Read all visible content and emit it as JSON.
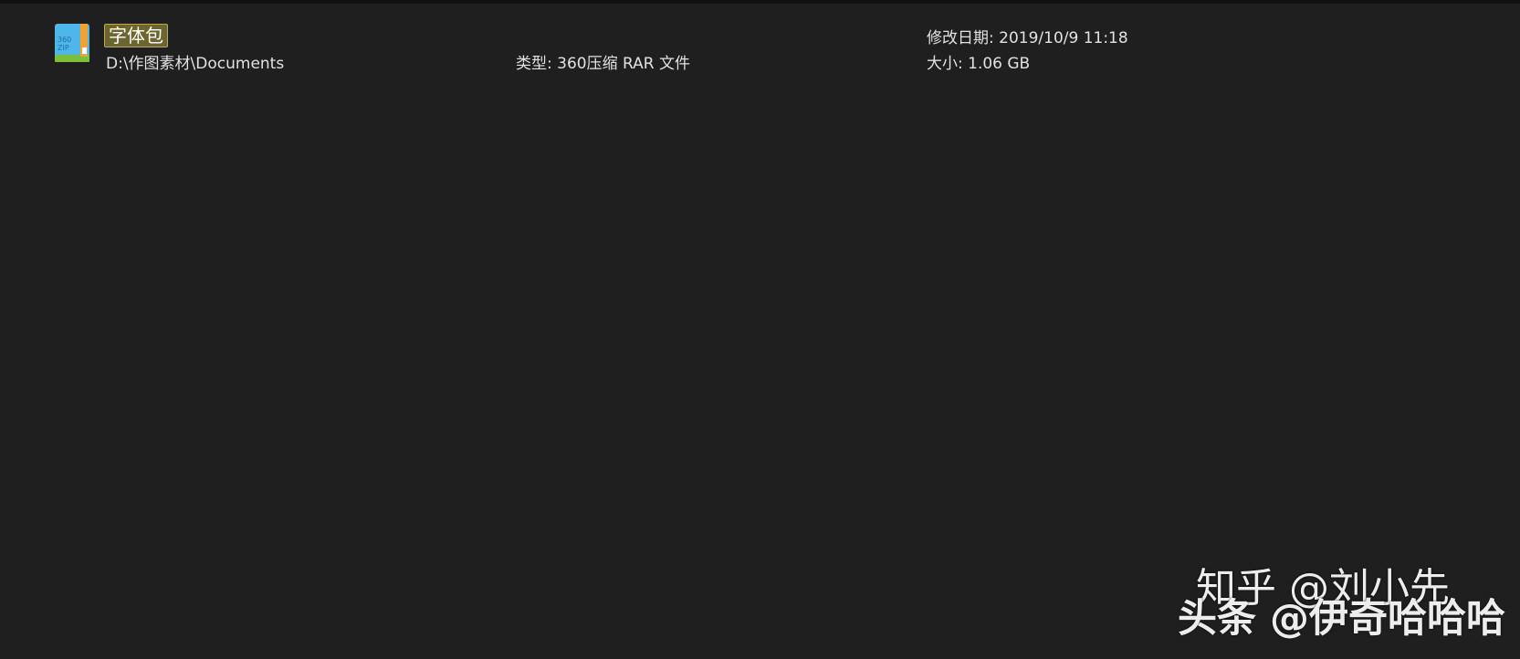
{
  "search_result": {
    "name": "字体包",
    "path": "D:\\作图素材\\Documents",
    "type_label": "类型: 360压缩 RAR 文件",
    "modified_label": "修改日期: 2019/10/9 11:18",
    "size_label": "大小: 1.06 GB",
    "icon": "archive-rar-icon",
    "icon_text_top": "360",
    "icon_text_bottom": "ZIP"
  },
  "watermarks": {
    "line1": "知乎 @刘小先",
    "line2": "头条 @伊奇哈哈哈"
  },
  "colors": {
    "background": "#1f1f1f",
    "highlight": "#6d6530",
    "highlight_border": "#b8a85a",
    "icon_blue": "#4fb6ea",
    "icon_orange": "#f2a233",
    "icon_green": "#7bbf3b"
  }
}
